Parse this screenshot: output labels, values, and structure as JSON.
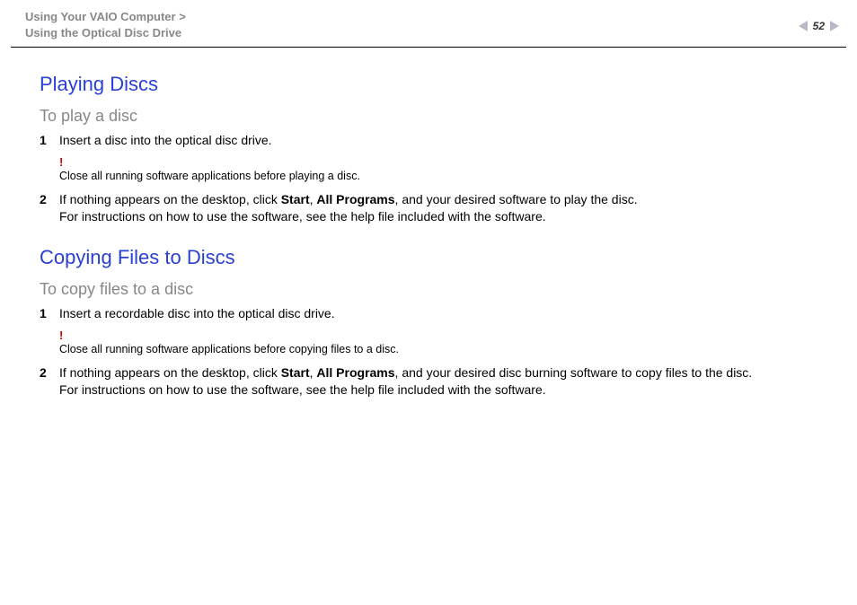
{
  "header": {
    "breadcrumb_line1": "Using Your VAIO Computer",
    "breadcrumb_line2": "Using the Optical Disc Drive",
    "page_number": "52"
  },
  "sections": {
    "playing": {
      "title": "Playing Discs",
      "subtitle": "To play a disc",
      "step1_num": "1",
      "step1_text": "Insert a disc into the optical disc drive.",
      "note_bang": "!",
      "note_text": "Close all running software applications before playing a disc.",
      "step2_num": "2",
      "step2_pre": "If nothing appears on the desktop, click ",
      "step2_b1": "Start",
      "step2_mid1": ", ",
      "step2_b2": "All Programs",
      "step2_post": ", and your desired software to play the disc.",
      "step2_line2": "For instructions on how to use the software, see the help file included with the software."
    },
    "copying": {
      "title": "Copying Files to Discs",
      "subtitle": "To copy files to a disc",
      "step1_num": "1",
      "step1_text": "Insert a recordable disc into the optical disc drive.",
      "note_bang": "!",
      "note_text": "Close all running software applications before copying files to a disc.",
      "step2_num": "2",
      "step2_pre": "If nothing appears on the desktop, click ",
      "step2_b1": "Start",
      "step2_mid1": ", ",
      "step2_b2": "All Programs",
      "step2_post": ", and your desired disc burning software to copy files to the disc.",
      "step2_line2": "For instructions on how to use the software, see the help file included with the software."
    }
  }
}
